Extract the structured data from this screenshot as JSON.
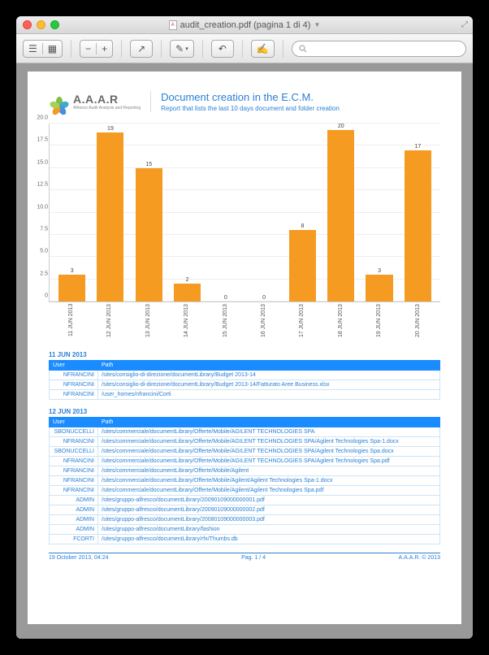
{
  "window": {
    "title": "audit_creation.pdf (pagina 1 di 4)"
  },
  "toolbar": {
    "view": "☰",
    "thumbs": "▦",
    "zoom_out": "−",
    "zoom_in": "+",
    "share": "↗",
    "highlight": "✎",
    "marker": "⟋",
    "undo": "↶",
    "edit": "✍",
    "search_placeholder": ""
  },
  "document": {
    "logo_name": "A.A.A.R",
    "logo_sub": "Alfresco Audit Analysis and Reporting",
    "title": "Document creation in the E.C.M.",
    "subtitle": "Report that lists the last 10 days document and folder creation"
  },
  "chart_data": {
    "type": "bar",
    "categories": [
      "11 JUN 2013",
      "12 JUN 2013",
      "13 JUN 2013",
      "14 JUN 2013",
      "15 JUN 2013",
      "16 JUN 2013",
      "17 JUN 2013",
      "18 JUN 2013",
      "19 JUN 2013",
      "20 JUN 2013"
    ],
    "values": [
      3,
      19,
      15,
      2,
      0,
      0,
      8,
      20,
      3,
      17
    ],
    "ylim": [
      0,
      20
    ],
    "yticks": [
      0,
      2.5,
      5.0,
      7.5,
      10.0,
      12.5,
      15.0,
      17.5,
      20.0
    ]
  },
  "tables": [
    {
      "date": "11 JUN 2013",
      "headers": {
        "user": "User",
        "path": "Path"
      },
      "rows": [
        {
          "user": "NFRANCINI",
          "path": "/sites/consiglio-di-direzione/documentLibrary/Budget 2013-14"
        },
        {
          "user": "NFRANCINI",
          "path": "/sites/consiglio-di-direzione/documentLibrary/Budget 2013-14/Fatturato Aree Business.xlsx"
        },
        {
          "user": "NFRANCINI",
          "path": "/user_homes/nfrancini/Corti"
        }
      ]
    },
    {
      "date": "12 JUN 2013",
      "headers": {
        "user": "User",
        "path": "Path"
      },
      "rows": [
        {
          "user": "SBONUCCELLI",
          "path": "/sites/commerciale/documentLibrary/Offerte/Mobile/AGILENT TECHNOLOGIES SPA"
        },
        {
          "user": "NFRANCINI",
          "path": "/sites/commerciale/documentLibrary/Offerte/Mobile/AGILENT TECHNOLOGIES SPA/Agilent Technologies Spa-1.docx"
        },
        {
          "user": "SBONUCCELLI",
          "path": "/sites/commerciale/documentLibrary/Offerte/Mobile/AGILENT TECHNOLOGIES SPA/Agilent Technologies Spa.docx"
        },
        {
          "user": "NFRANCINI",
          "path": "/sites/commerciale/documentLibrary/Offerte/Mobile/AGILENT TECHNOLOGIES SPA/Agilent Technologies Spa.pdf"
        },
        {
          "user": "NFRANCINI",
          "path": "/sites/commerciale/documentLibrary/Offerte/Mobile/Agilent"
        },
        {
          "user": "NFRANCINI",
          "path": "/sites/commerciale/documentLibrary/Offerte/Mobile/Agilent/Agilent Technologies Spa-1.docx"
        },
        {
          "user": "NFRANCINI",
          "path": "/sites/commerciale/documentLibrary/Offerte/Mobile/Agilent/Agilent Technologies Spa.pdf"
        },
        {
          "user": "ADMIN",
          "path": "/sites/gruppo-alfresco/documentLibrary/20090109000000001.pdf"
        },
        {
          "user": "ADMIN",
          "path": "/sites/gruppo-alfresco/documentLibrary/20090109000000002.pdf"
        },
        {
          "user": "ADMIN",
          "path": "/sites/gruppo-alfresco/documentLibrary/20080109000000003.pdf"
        },
        {
          "user": "ADMIN",
          "path": "/sites/gruppo-alfresco/documentLibrary/fashion"
        },
        {
          "user": "FCORTI",
          "path": "/sites/gruppo-alfresco/documentLibrary/rfx/Thumbs.db"
        }
      ]
    }
  ],
  "footer": {
    "left": "19 October 2013, 04:24",
    "center": "Pag. 1 / 4",
    "right": "A.A.A.R. © 2013"
  }
}
